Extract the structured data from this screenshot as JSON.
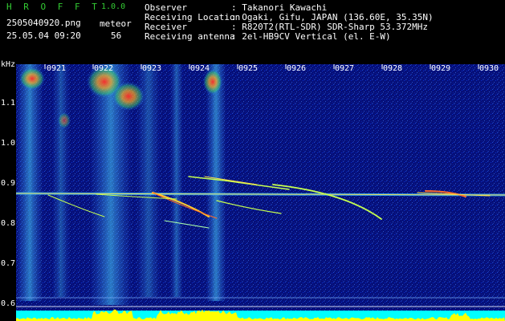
{
  "app": {
    "name": "H R O F F T",
    "version": "1.0.0"
  },
  "file": {
    "name": "2505040920.png",
    "timestamp": "25.05.04 09:20"
  },
  "meteor": {
    "label": "meteor",
    "count": "56"
  },
  "info": [
    {
      "key": "Observer",
      "value": ": Takanori Kawachi"
    },
    {
      "key": "Receiving Location",
      "value": ": Ogaki, Gifu, JAPAN (136.60E, 35.35N)"
    },
    {
      "key": "Receiver",
      "value": ": R820T2(RTL-SDR) SDR-Sharp 53.372MHz"
    },
    {
      "key": "Receiving antenna",
      "value": ": 2el-HB9CV Vertical (el. E-W)"
    }
  ],
  "axes": {
    "y_unit": "kHz",
    "y_ticks": [
      "1.1",
      "1.0",
      "0.9",
      "0.8",
      "0.7",
      "0.6"
    ],
    "x_ticks": [
      "0921",
      "0922",
      "0923",
      "0924",
      "0925",
      "0926",
      "0927",
      "0928",
      "0929",
      "0930"
    ]
  },
  "colors": {
    "background": "#06107a",
    "carrier": "#ffe04a",
    "meteor_trail": "#c6ff50",
    "level_bar": "#ffff00",
    "level_base": "#00ffff"
  }
}
